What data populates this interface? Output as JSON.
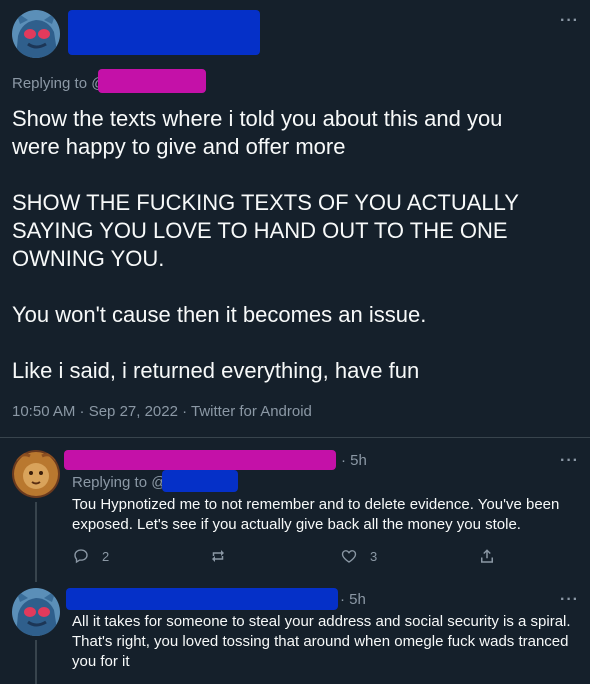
{
  "main_tweet": {
    "more_icon": "more-dots-icon",
    "replying_prefix": "Replying to @",
    "paragraphs": [
      "Show the texts where i told you about this and you were happy to give and offer more",
      "SHOW THE FUCKING TEXTS OF YOU ACTUALLY SAYING YOU LOVE TO HAND OUT TO THE ONE OWNING YOU.",
      "You won't cause then it becomes an issue.",
      "Like i said, i returned everything, have fun"
    ],
    "meta": "10:50 AM · Sep 27, 2022 · Twitter for Android"
  },
  "reply_1": {
    "time": "· 5h",
    "replying_prefix": "Replying to @",
    "text": "Tou Hypnotized me to not remember and to delete evidence. You've been exposed. Let's see if you actually give back all the money you stole.",
    "actions": {
      "reply_count": "2",
      "retweet_count": "",
      "like_count": "3"
    }
  },
  "reply_2": {
    "time": "· 5h",
    "text": "All it takes for someone to steal your address and social security is a spiral. That's right, you loved tossing that around when omegle fuck wads tranced you for it"
  },
  "colors": {
    "background": "#15202b",
    "accent": "#1d9bf0",
    "redaction_blue": "#0530c8",
    "redaction_pink": "#c411a8"
  }
}
